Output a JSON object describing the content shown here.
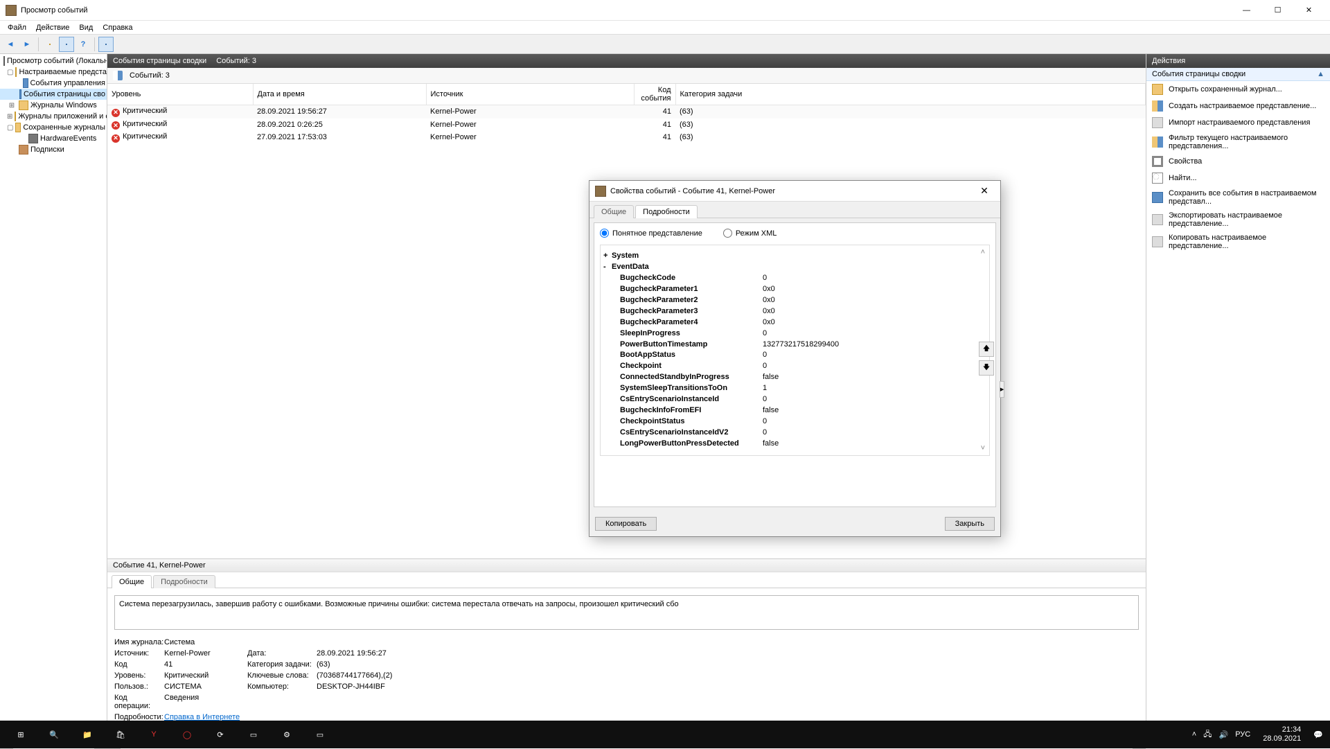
{
  "window": {
    "title": "Просмотр событий"
  },
  "menu": {
    "file": "Файл",
    "action": "Действие",
    "view": "Вид",
    "help": "Справка"
  },
  "tree": {
    "root": "Просмотр событий (Локальны",
    "custom": "Настраиваемые представ",
    "manage": "События управления",
    "summary": "События страницы сво",
    "winlogs": "Журналы Windows",
    "applogs": "Журналы приложений и сл",
    "savedlogs": "Сохраненные журналы",
    "hardware": "HardwareEvents",
    "subs": "Подписки"
  },
  "center": {
    "heading": "События страницы сводки",
    "heading_count": "Событий: 3",
    "filter_label": "Событий: 3",
    "cols": {
      "level": "Уровень",
      "date": "Дата и время",
      "source": "Источник",
      "id": "Код события",
      "task": "Категория задачи"
    },
    "rows": [
      {
        "level": "Критический",
        "date": "28.09.2021 19:56:27",
        "source": "Kernel-Power",
        "id": "41",
        "task": "(63)"
      },
      {
        "level": "Критический",
        "date": "28.09.2021 0:26:25",
        "source": "Kernel-Power",
        "id": "41",
        "task": "(63)"
      },
      {
        "level": "Критический",
        "date": "27.09.2021 17:53:03",
        "source": "Kernel-Power",
        "id": "41",
        "task": "(63)"
      }
    ]
  },
  "detail": {
    "header": "Событие 41, Kernel-Power",
    "tabs": {
      "general": "Общие",
      "details": "Подробности"
    },
    "desc": "Система перезагрузилась, завершив работу с ошибками. Возможные причины ошибки: система перестала отвечать на запросы, произошел критический сбо",
    "labels": {
      "log": "Имя журнала:",
      "source": "Источник:",
      "id": "Код",
      "level": "Уровень:",
      "user": "Пользов.:",
      "opcode": "Код операции:",
      "details": "Подробности:",
      "date": "Дата:",
      "task": "Категория задачи:",
      "keywords": "Ключевые слова:",
      "computer": "Компьютер:"
    },
    "values": {
      "log": "Система",
      "source": "Kernel-Power",
      "id": "41",
      "level": "Критический",
      "user": "СИСТЕМА",
      "opcode": "Сведения",
      "link": "Справка в Интернете для ",
      "date": "28.09.2021 19:56:27",
      "task": "(63)",
      "keywords": "(70368744177664),(2)",
      "computer": "DESKTOP-JH44IBF"
    }
  },
  "actions": {
    "title": "Действия",
    "group": "События страницы сводки",
    "items": [
      "Открыть сохраненный журнал...",
      "Создать настраиваемое представление...",
      "Импорт настраиваемого представления",
      "Фильтр текущего настраиваемого представления...",
      "Свойства",
      "Найти...",
      "Сохранить все события в настраиваемом представл...",
      "Экспортировать настраиваемое представление...",
      "Копировать настраиваемое представление..."
    ]
  },
  "dialog": {
    "title": "Свойства событий - Событие 41, Kernel-Power",
    "tabs": {
      "general": "Общие",
      "details": "Подробности"
    },
    "radio": {
      "friendly": "Понятное представление",
      "xml": "Режим XML"
    },
    "system": "System",
    "eventdata": "EventData",
    "props": [
      {
        "k": "BugcheckCode",
        "v": "0"
      },
      {
        "k": "BugcheckParameter1",
        "v": "0x0"
      },
      {
        "k": "BugcheckParameter2",
        "v": "0x0"
      },
      {
        "k": "BugcheckParameter3",
        "v": "0x0"
      },
      {
        "k": "BugcheckParameter4",
        "v": "0x0"
      },
      {
        "k": "SleepInProgress",
        "v": "0"
      },
      {
        "k": "PowerButtonTimestamp",
        "v": "132773217518299400"
      },
      {
        "k": "BootAppStatus",
        "v": "0"
      },
      {
        "k": "Checkpoint",
        "v": "0"
      },
      {
        "k": "ConnectedStandbyInProgress",
        "v": "false"
      },
      {
        "k": "SystemSleepTransitionsToOn",
        "v": "1"
      },
      {
        "k": "CsEntryScenarioInstanceId",
        "v": "0"
      },
      {
        "k": "BugcheckInfoFromEFI",
        "v": "false"
      },
      {
        "k": "CheckpointStatus",
        "v": "0"
      },
      {
        "k": "CsEntryScenarioInstanceIdV2",
        "v": "0"
      },
      {
        "k": "LongPowerButtonPressDetected",
        "v": "false"
      }
    ],
    "buttons": {
      "copy": "Копировать",
      "close": "Закрыть"
    }
  },
  "taskbar": {
    "lang": "РУС",
    "time": "21:34",
    "date": "28.09.2021"
  }
}
